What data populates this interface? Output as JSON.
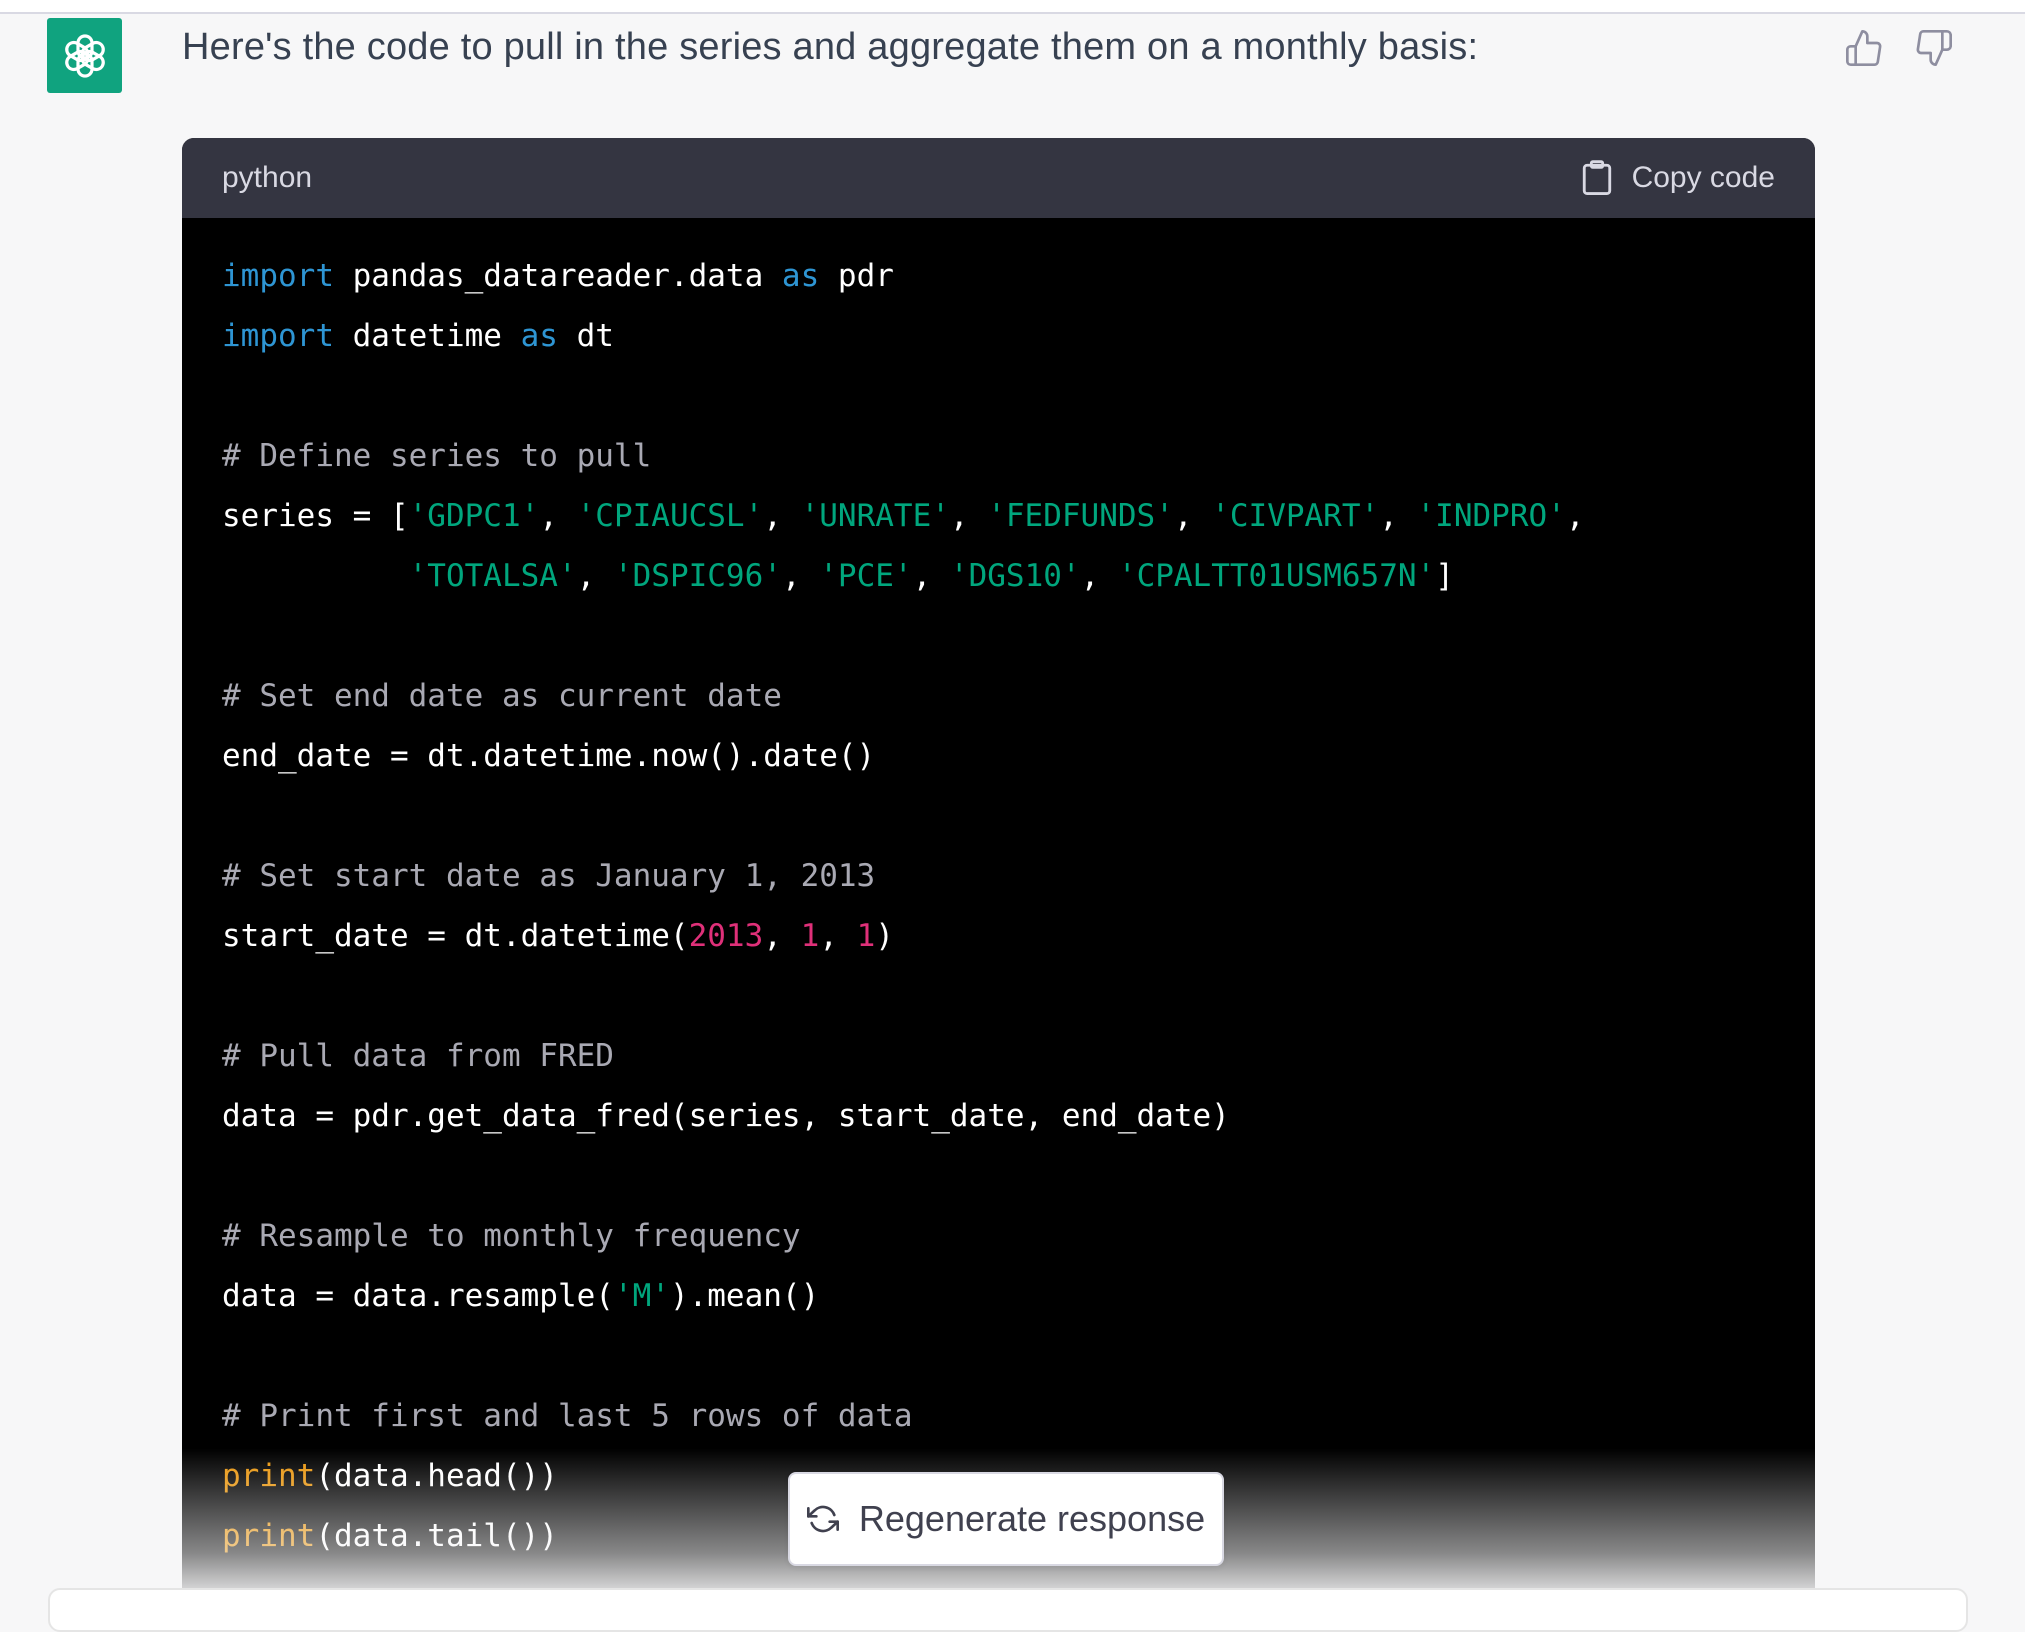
{
  "message": {
    "text": "Here's the code to pull in the series and aggregate them on a monthly basis:"
  },
  "avatar": {
    "icon": "openai-logo-icon",
    "color": "#10a37f"
  },
  "feedback": {
    "up_icon": "thumbs-up-icon",
    "down_icon": "thumbs-down-icon"
  },
  "code_block": {
    "language": "python",
    "copy_label": "Copy code",
    "copy_icon": "clipboard-icon",
    "lines": [
      [
        {
          "t": "import",
          "c": "kw"
        },
        {
          "t": " pandas_datareader.data "
        },
        {
          "t": "as",
          "c": "kw"
        },
        {
          "t": " pdr"
        }
      ],
      [
        {
          "t": "import",
          "c": "kw"
        },
        {
          "t": " datetime "
        },
        {
          "t": "as",
          "c": "kw"
        },
        {
          "t": " dt"
        }
      ],
      [],
      [
        {
          "t": "# Define series to pull",
          "c": "cm"
        }
      ],
      [
        {
          "t": "series = ["
        },
        {
          "t": "'GDPC1'",
          "c": "str"
        },
        {
          "t": ", "
        },
        {
          "t": "'CPIAUCSL'",
          "c": "str"
        },
        {
          "t": ", "
        },
        {
          "t": "'UNRATE'",
          "c": "str"
        },
        {
          "t": ", "
        },
        {
          "t": "'FEDFUNDS'",
          "c": "str"
        },
        {
          "t": ", "
        },
        {
          "t": "'CIVPART'",
          "c": "str"
        },
        {
          "t": ", "
        },
        {
          "t": "'INDPRO'",
          "c": "str"
        },
        {
          "t": ","
        }
      ],
      [
        {
          "t": "          "
        },
        {
          "t": "'TOTALSA'",
          "c": "str"
        },
        {
          "t": ", "
        },
        {
          "t": "'DSPIC96'",
          "c": "str"
        },
        {
          "t": ", "
        },
        {
          "t": "'PCE'",
          "c": "str"
        },
        {
          "t": ", "
        },
        {
          "t": "'DGS10'",
          "c": "str"
        },
        {
          "t": ", "
        },
        {
          "t": "'CPALTT01USM657N'",
          "c": "str"
        },
        {
          "t": "]"
        }
      ],
      [],
      [
        {
          "t": "# Set end date as current date",
          "c": "cm"
        }
      ],
      [
        {
          "t": "end_date = dt.datetime.now().date()"
        }
      ],
      [],
      [
        {
          "t": "# Set start date as January 1, 2013",
          "c": "cm"
        }
      ],
      [
        {
          "t": "start_date = dt.datetime("
        },
        {
          "t": "2013",
          "c": "num"
        },
        {
          "t": ", "
        },
        {
          "t": "1",
          "c": "num"
        },
        {
          "t": ", "
        },
        {
          "t": "1",
          "c": "num"
        },
        {
          "t": ")"
        }
      ],
      [],
      [
        {
          "t": "# Pull data from FRED",
          "c": "cm"
        }
      ],
      [
        {
          "t": "data = pdr.get_data_fred(series, start_date, end_date)"
        }
      ],
      [],
      [
        {
          "t": "# Resample to monthly frequency",
          "c": "cm"
        }
      ],
      [
        {
          "t": "data = data.resample("
        },
        {
          "t": "'M'",
          "c": "str"
        },
        {
          "t": ").mean()"
        }
      ],
      [],
      [
        {
          "t": "# Print first and last 5 rows of data",
          "c": "cm"
        }
      ],
      [
        {
          "t": "print",
          "c": "fn"
        },
        {
          "t": "(data.head())"
        }
      ],
      [
        {
          "t": "print",
          "c": "fn"
        },
        {
          "t": "(data.tail())"
        }
      ]
    ]
  },
  "regenerate": {
    "label": "Regenerate response",
    "icon": "refresh-icon"
  },
  "colors": {
    "keyword": "#2e95d3",
    "string": "#00a67d",
    "number": "#df3079",
    "comment": "#a9a9b3",
    "builtin": "#e9950c"
  }
}
